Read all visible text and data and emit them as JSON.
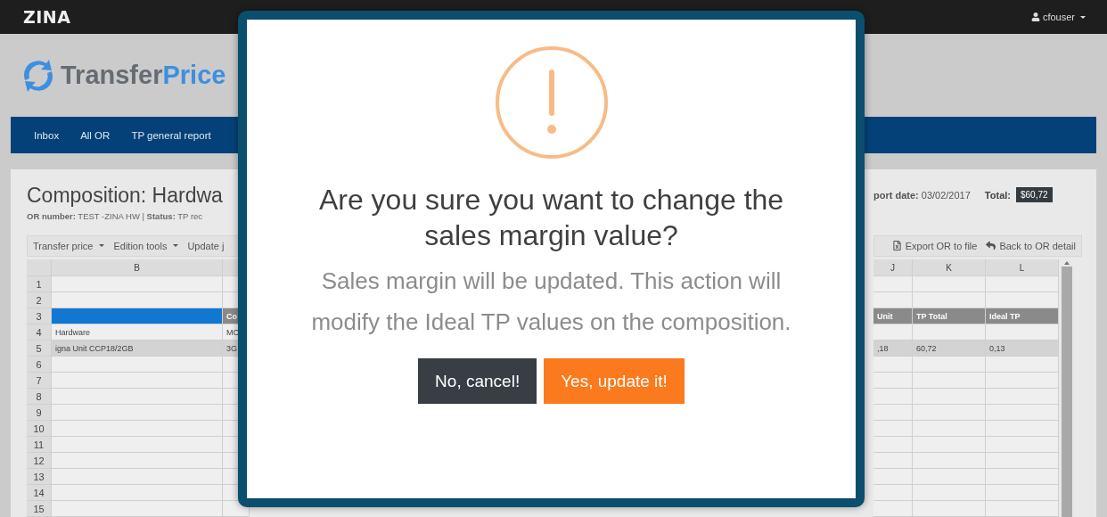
{
  "top_bar": {
    "brand": "ZINA",
    "user": "cfouser"
  },
  "logo": {
    "first": "Transfer",
    "second": "Price"
  },
  "nav": [
    "Inbox",
    "All OR",
    "TP general report"
  ],
  "composition": {
    "title": "Composition: Hardwa",
    "meta": "**OR number:** TEST -ZINA HW | **Status:** TP rec",
    "report_date": "**port date:** 03/02/2017",
    "total_label": "Total:",
    "total": "$60,72"
  },
  "toolbar_left": [
    {
      "label": "Transfer price",
      "kind": "dropdown"
    },
    {
      "label": "Edition tools",
      "kind": "dropdown"
    },
    {
      "label": "Update j",
      "kind": "plain"
    }
  ],
  "toolbar_right": [
    {
      "label": "Export OR to file",
      "kind": "export"
    },
    {
      "label": "Back to OR detail",
      "kind": "back"
    }
  ],
  "sheet": {
    "left_columns": [
      "B"
    ],
    "right_columns": [
      "J",
      "K",
      "L"
    ],
    "rows": [
      {
        "number": "1",
        "kind": "data",
        "shaded": false
      },
      {
        "number": "2",
        "kind": "data",
        "shaded": false
      },
      {
        "number": "3",
        "kind": "header",
        "shaded": false,
        "c": "Co",
        "j": "Unit",
        "k": "TP Total",
        "l": "Ideal TP"
      },
      {
        "number": "4",
        "kind": "data",
        "shaded": false,
        "b": "Hardware",
        "c": "MO"
      },
      {
        "number": "5",
        "kind": "data",
        "shaded": true,
        "b": "igna Unit CCP18/2GB",
        "c": "3G",
        "j": ",18",
        "k": "60,72",
        "l": "0,13"
      },
      {
        "number": "6",
        "kind": "data",
        "shaded": false
      },
      {
        "number": "7",
        "kind": "data",
        "shaded": false
      },
      {
        "number": "8",
        "kind": "data",
        "shaded": false
      },
      {
        "number": "9",
        "kind": "data",
        "shaded": false
      },
      {
        "number": "10",
        "kind": "data",
        "shaded": false
      },
      {
        "number": "11",
        "kind": "data",
        "shaded": false
      },
      {
        "number": "12",
        "kind": "data",
        "shaded": false
      },
      {
        "number": "13",
        "kind": "data",
        "shaded": false
      },
      {
        "number": "14",
        "kind": "data",
        "shaded": false
      },
      {
        "number": "15",
        "kind": "data",
        "shaded": false
      }
    ]
  },
  "dialog": {
    "title": "Are you sure you want to change the sales margin value?",
    "text": "Sales margin will be updated. This action will modify the Ideal TP values on the composition.",
    "buttons": [
      {
        "label": "No, cancel!",
        "kind": "cancel"
      },
      {
        "label": "Yes, update it!",
        "kind": "confirm"
      }
    ]
  }
}
